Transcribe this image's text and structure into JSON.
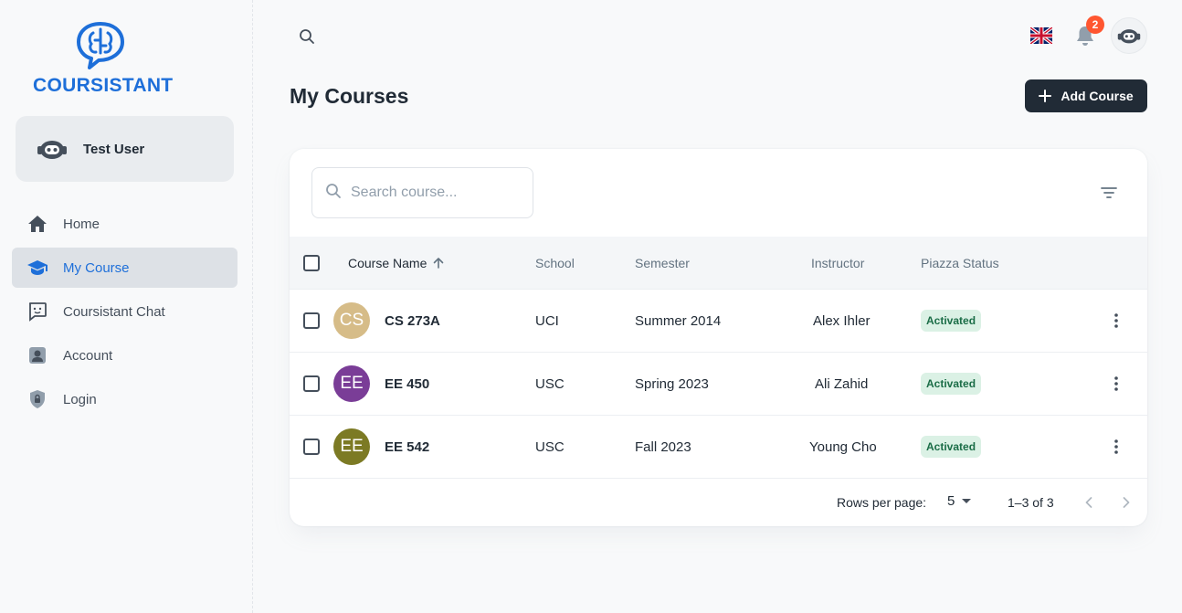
{
  "app": {
    "logo_text": "COURSISTANT"
  },
  "user": {
    "name": "Test User"
  },
  "sidebar": {
    "items": [
      {
        "label": "Home",
        "icon": "home-icon",
        "active": false
      },
      {
        "label": "My Course",
        "icon": "graduation-cap-icon",
        "active": true
      },
      {
        "label": "Coursistant Chat",
        "icon": "chat-icon",
        "active": false
      },
      {
        "label": "Account",
        "icon": "account-icon",
        "active": false
      },
      {
        "label": "Login",
        "icon": "lock-icon",
        "active": false
      }
    ]
  },
  "header": {
    "notifications_count": "2",
    "language_flag": "uk-flag-icon"
  },
  "page": {
    "title": "My Courses",
    "add_button": "Add Course"
  },
  "table": {
    "search_placeholder": "Search course...",
    "columns": {
      "name": "Course Name",
      "school": "School",
      "semester": "Semester",
      "instructor": "Instructor",
      "status": "Piazza Status"
    },
    "rows": [
      {
        "initials": "CS",
        "avatar_color": "#d6bc88",
        "name": "CS 273A",
        "school": "UCI",
        "semester": "Summer 2014",
        "instructor": "Alex Ihler",
        "status": "Activated"
      },
      {
        "initials": "EE",
        "avatar_color": "#7a3d97",
        "name": "EE 450",
        "school": "USC",
        "semester": "Spring 2023",
        "instructor": "Ali Zahid",
        "status": "Activated"
      },
      {
        "initials": "EE",
        "avatar_color": "#7c7a24",
        "name": "EE 542",
        "school": "USC",
        "semester": "Fall 2023",
        "instructor": "Young Cho",
        "status": "Activated"
      }
    ],
    "footer": {
      "rows_per_page_label": "Rows per page:",
      "rows_per_page": "5",
      "range": "1–3 of 3"
    }
  },
  "colors": {
    "accent": "#1e6fd9",
    "dark": "#212b36",
    "status_bg": "#dbf1e5",
    "badge": "#ff5630"
  }
}
